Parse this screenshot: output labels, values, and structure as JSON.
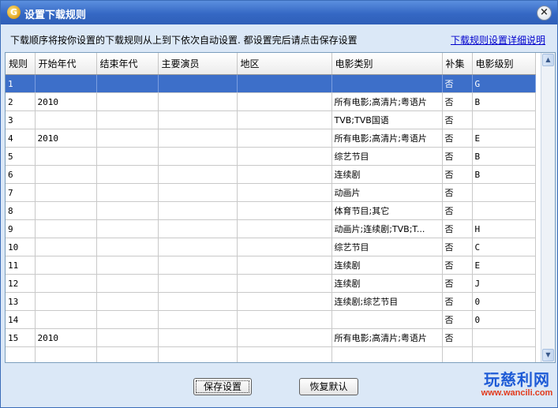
{
  "window": {
    "title": "设置下载规则",
    "close_glyph": "×",
    "icon": "app-logo-icon"
  },
  "instruction": "下载顺序将按你设置的下载规则从上到下依次自动设置. 都设置完后请点击保存设置",
  "help_link": "下载规则设置详细说明",
  "table": {
    "headers": [
      "规则",
      "开始年代",
      "结束年代",
      "主要演员",
      "地区",
      "电影类别",
      "补集",
      "电影级别"
    ],
    "rows": [
      [
        "1",
        "",
        "",
        "",
        "",
        "",
        "否",
        "G"
      ],
      [
        "2",
        "2010",
        "",
        "",
        "",
        "所有电影;高清片;粤语片",
        "否",
        "B"
      ],
      [
        "3",
        "",
        "",
        "",
        "",
        "TVB;TVB国语",
        "否",
        ""
      ],
      [
        "4",
        "2010",
        "",
        "",
        "",
        "所有电影;高清片;粤语片",
        "否",
        "E"
      ],
      [
        "5",
        "",
        "",
        "",
        "",
        "综艺节目",
        "否",
        "B"
      ],
      [
        "6",
        "",
        "",
        "",
        "",
        "连续剧",
        "否",
        "B"
      ],
      [
        "7",
        "",
        "",
        "",
        "",
        "动画片",
        "否",
        ""
      ],
      [
        "8",
        "",
        "",
        "",
        "",
        "体育节目;其它",
        "否",
        ""
      ],
      [
        "9",
        "",
        "",
        "",
        "",
        "动画片;连续剧;TVB;T...",
        "否",
        "H"
      ],
      [
        "10",
        "",
        "",
        "",
        "",
        "综艺节目",
        "否",
        "C"
      ],
      [
        "11",
        "",
        "",
        "",
        "",
        "连续剧",
        "否",
        "E"
      ],
      [
        "12",
        "",
        "",
        "",
        "",
        "连续剧",
        "否",
        "J"
      ],
      [
        "13",
        "",
        "",
        "",
        "",
        "连续剧;综艺节目",
        "否",
        "0"
      ],
      [
        "14",
        "",
        "",
        "",
        "",
        "",
        "否",
        "0"
      ],
      [
        "15",
        "2010",
        "",
        "",
        "",
        "所有电影;高清片;粤语片",
        "否",
        ""
      ],
      [
        "",
        "",
        "",
        "",
        "",
        "",
        "",
        ""
      ]
    ],
    "selected_row": 0
  },
  "buttons": {
    "save": "保存设置",
    "restore": "恢复默认"
  },
  "watermark": {
    "title": "玩慈利网",
    "url": "www.wancili.com"
  },
  "colors": {
    "titlebar": "#3568c4",
    "selection": "#3d6fc9",
    "link": "#0000cc",
    "watermark_title": "#1e5bd6",
    "watermark_url": "#e23a1b"
  }
}
